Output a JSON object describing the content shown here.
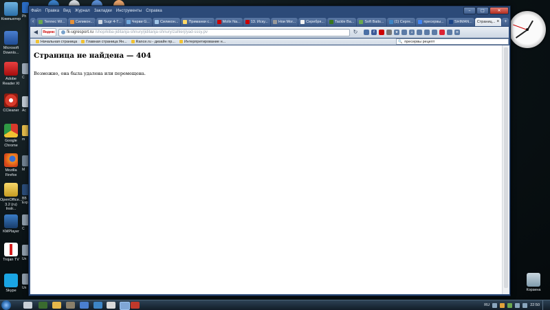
{
  "desktop": {
    "icons": [
      {
        "label": "Компьютер",
        "icon": "computer-icon"
      },
      {
        "label": "Microsoft Downlo...",
        "icon": "download-manager-icon"
      },
      {
        "label": "Adobe Reader XI",
        "icon": "adobe-reader-icon"
      },
      {
        "label": "CCleaner",
        "icon": "ccleaner-icon"
      },
      {
        "label": "Google Chrome",
        "icon": "chrome-icon"
      },
      {
        "label": "Mozilla Firefox",
        "icon": "firefox-icon"
      },
      {
        "label": "OpenOffice... 3.2 (ru) Instr...",
        "icon": "folder-icon"
      },
      {
        "label": "KMPlayer",
        "icon": "kmplayer-icon"
      },
      {
        "label": "Trojan TV",
        "icon": "trojan-tv-icon"
      },
      {
        "label": "Skype",
        "icon": "skype-icon"
      }
    ],
    "peek_labels": [
      "Ph",
      "C",
      "Ac",
      "m",
      "M",
      "BB Exp",
      "C",
      "Un",
      "Un",
      "Un"
    ],
    "recycle_bin_label": "Корзина"
  },
  "browser": {
    "menu": [
      "Файл",
      "Правка",
      "Вид",
      "Журнал",
      "Закладки",
      "Инструменты",
      "Справка"
    ],
    "window_controls": {
      "minimize": "–",
      "maximize": "□",
      "close": "✕"
    },
    "tabs": [
      {
        "label": "Tennec Wi...",
        "active": false
      },
      {
        "label": "Силикон...",
        "active": false
      },
      {
        "label": "Sugr 4-7...",
        "active": false
      },
      {
        "label": "Черви G...",
        "active": false
      },
      {
        "label": "Силикон...",
        "active": false
      },
      {
        "label": "Приманки с...",
        "active": false
      },
      {
        "label": "Molix Na...",
        "active": false
      },
      {
        "label": "13. Иску...",
        "active": false
      },
      {
        "label": "Нои Мог...",
        "active": false
      },
      {
        "label": "Серебря...",
        "active": false
      },
      {
        "label": "Tackle Ba...",
        "active": false
      },
      {
        "label": "Soft Baits...",
        "active": false
      },
      {
        "label": "(1) Серге...",
        "active": false
      },
      {
        "label": "пресервы...",
        "active": false
      },
      {
        "label": "SHIMAN...",
        "active": false
      },
      {
        "label": "Страниц...",
        "active": true
      }
    ],
    "address": {
      "host": "fk-ugresport.ru",
      "path": "/shop/kiba-jiditanja-shnury/jiditanja-shnury/zahlerj/yad-sssy.pv"
    },
    "yandex_label": "Яндекс",
    "bookmarks": [
      "Начальная страница",
      "Главная страница Ян...",
      "Rance.ru - дизайн пр...",
      "Интерпретирование н..."
    ],
    "search_field": "пресервы рецепт"
  },
  "page": {
    "heading": "Страница не найдена — 404",
    "message": "Возможно, она была удалена или перемещена."
  },
  "taskbar": {
    "lang": "RU",
    "time": "22:50"
  }
}
